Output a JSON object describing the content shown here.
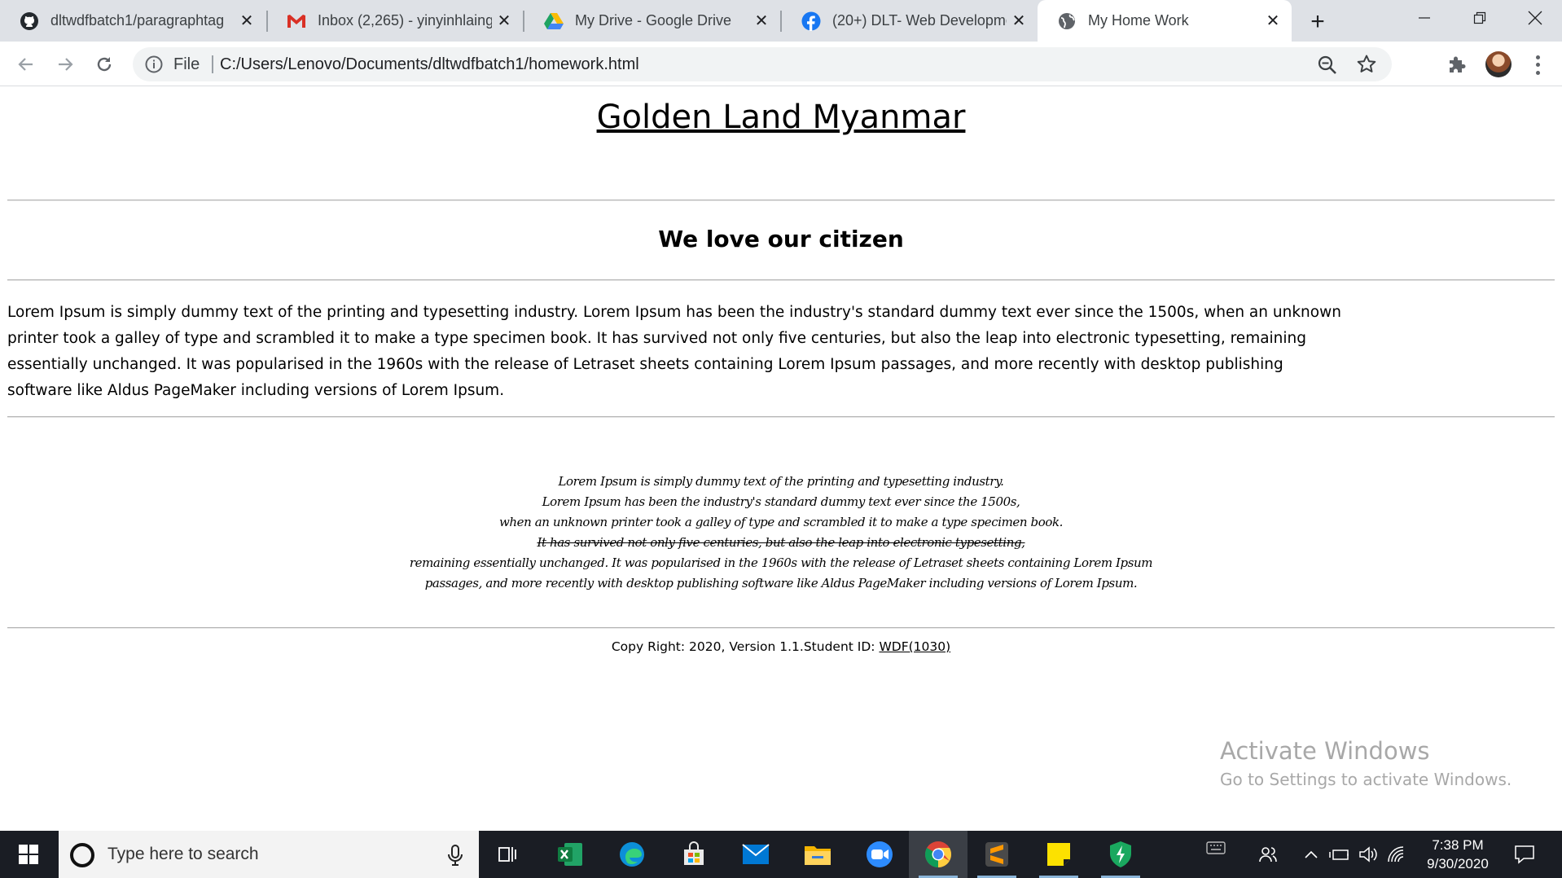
{
  "browser": {
    "tabs": [
      {
        "title": "dltwdfbatch1/paragraphtag",
        "icon": "github-icon",
        "active": false
      },
      {
        "title": "Inbox (2,265) - yinyinhlaing",
        "icon": "gmail-icon",
        "active": false
      },
      {
        "title": "My Drive - Google Drive",
        "icon": "google-drive-icon",
        "active": false
      },
      {
        "title": "(20+) DLT- Web Developme",
        "icon": "facebook-icon",
        "active": false
      },
      {
        "title": "My Home Work",
        "icon": "globe-icon",
        "active": true
      }
    ],
    "new_tab_label": "+",
    "address": {
      "scheme_label": "File",
      "url": "C:/Users/Lenovo/Documents/dltwdfbatch1/homework.html"
    }
  },
  "page": {
    "heading": "Golden Land Myanmar",
    "subheading": "We love our citizen",
    "paragraph": "Lorem Ipsum is simply dummy text of the printing and typesetting industry. Lorem Ipsum has been the industry's standard dummy text ever since the 1500s, when an unknown printer took a galley of type and scrambled it to make a type specimen book. It has survived not only five centuries, but also the leap into electronic typesetting, remaining essentially unchanged. It was popularised in the 1960s with the release of Letraset sheets containing Lorem Ipsum passages, and more recently with desktop publishing software like Aldus PageMaker including versions of Lorem Ipsum.",
    "poem_lines": [
      "Lorem Ipsum is simply dummy text of the printing and typesetting industry.",
      "Lorem Ipsum has been the industry's standard dummy text ever since the 1500s,",
      "when an unknown printer took a galley of type and scrambled it to make a type specimen book.",
      "It has survived not only five centuries, but also the leap into electronic typesetting,",
      "remaining essentially unchanged. It was popularised in the 1960s with the release of Letraset sheets containing Lorem Ipsum",
      "passages, and more recently with desktop publishing software like Aldus PageMaker including versions of Lorem Ipsum."
    ],
    "poem_struck_line_index": 3,
    "footer_text": "Copy Right: 2020, Version 1.1.Student ID: ",
    "footer_student_id": "WDF(1030)"
  },
  "watermark": {
    "line1": "Activate Windows",
    "line2": "Go to Settings to activate Windows."
  },
  "taskbar": {
    "search_placeholder": "Type here to search",
    "pinned_apps": [
      "task-view-icon",
      "excel-icon",
      "edge-icon",
      "store-icon",
      "mail-icon",
      "file-explorer-icon",
      "zoom-icon",
      "chrome-icon",
      "sublime-text-icon",
      "sticky-notes-icon",
      "security-shield-icon"
    ],
    "active_app": "chrome-icon",
    "clock_time": "7:38 PM",
    "clock_date": "9/30/2020"
  },
  "colors": {
    "tabstrip": "#dee1e6",
    "omnibox": "#f1f3f4",
    "taskbar": "#1a1d24",
    "rule": "#b4b4b4",
    "watermark": "#a8a8a8"
  }
}
